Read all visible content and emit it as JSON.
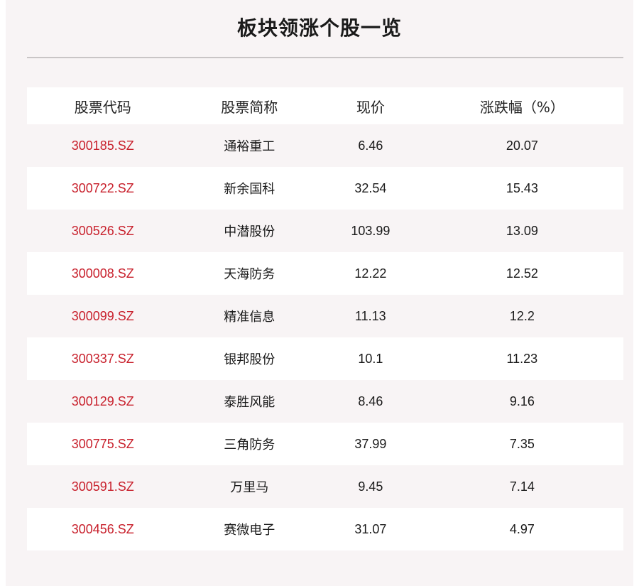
{
  "title": "板块领涨个股一览",
  "table": {
    "headers": [
      "股票代码",
      "股票简称",
      "现价",
      "涨跌幅（%）"
    ],
    "rows": [
      {
        "code": "300185.SZ",
        "name": "通裕重工",
        "price": "6.46",
        "change": "20.07"
      },
      {
        "code": "300722.SZ",
        "name": "新余国科",
        "price": "32.54",
        "change": "15.43"
      },
      {
        "code": "300526.SZ",
        "name": "中潜股份",
        "price": "103.99",
        "change": "13.09"
      },
      {
        "code": "300008.SZ",
        "name": "天海防务",
        "price": "12.22",
        "change": "12.52"
      },
      {
        "code": "300099.SZ",
        "name": "精准信息",
        "price": "11.13",
        "change": "12.2"
      },
      {
        "code": "300337.SZ",
        "name": "银邦股份",
        "price": "10.1",
        "change": "11.23"
      },
      {
        "code": "300129.SZ",
        "name": "泰胜风能",
        "price": "8.46",
        "change": "9.16"
      },
      {
        "code": "300775.SZ",
        "name": "三角防务",
        "price": "37.99",
        "change": "7.35"
      },
      {
        "code": "300591.SZ",
        "name": "万里马",
        "price": "9.45",
        "change": "7.14"
      },
      {
        "code": "300456.SZ",
        "name": "赛微电子",
        "price": "31.07",
        "change": "4.97"
      }
    ]
  },
  "colors": {
    "code_red": "#c8202c",
    "panel_bg": "#f8f4f5",
    "row_white": "#ffffff",
    "divider": "#c9c5c6"
  }
}
